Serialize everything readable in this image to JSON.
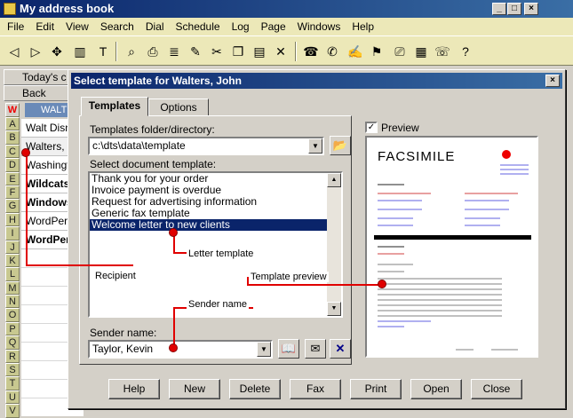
{
  "window": {
    "title": "My address book"
  },
  "menu": [
    "File",
    "Edit",
    "View",
    "Search",
    "Dial",
    "Schedule",
    "Log",
    "Page",
    "Windows",
    "Help"
  ],
  "nav": {
    "today_label": "Today's c",
    "back_label": "Back",
    "selected_label": "WALT"
  },
  "letters": [
    "A",
    "B",
    "C",
    "D",
    "E",
    "F",
    "G",
    "H",
    "I",
    "J",
    "K",
    "L",
    "M",
    "N",
    "O",
    "P",
    "Q",
    "R",
    "S",
    "T",
    "U",
    "V"
  ],
  "current_letter": "W",
  "contacts": [
    "Walt Disne",
    "Walters, J",
    "Washingto",
    "Wildcats",
    "Windows",
    "WordPerfe",
    "WordPer"
  ],
  "dialog": {
    "title": "Select template for Walters, John",
    "tabs": [
      "Templates",
      "Options"
    ],
    "folder_label": "Templates folder/directory:",
    "folder_value": "c:\\dts\\data\\template",
    "doc_label": "Select document template:",
    "templates": [
      "Thank you for your order",
      "Invoice payment is overdue",
      "Request for advertising information",
      "Generic fax template",
      "Welcome letter to new clients"
    ],
    "selected_template": 4,
    "sender_label": "Sender name:",
    "sender_value": "Taylor, Kevin",
    "preview_label": "Preview",
    "preview_checked": true,
    "preview_doc_title": "FACSIMILE",
    "buttons": [
      "Help",
      "New",
      "Delete",
      "Fax",
      "Print",
      "Open",
      "Close"
    ]
  },
  "annotations": {
    "letter_template": "Letter template",
    "recipient": "Recipient",
    "template_preview": "Template preview",
    "sender_name": "Sender name"
  },
  "colors": {
    "titlebar": "#0a246a",
    "menubar": "#ece8b8",
    "annotation_red": "#e00000",
    "selection": "#0a246a"
  }
}
